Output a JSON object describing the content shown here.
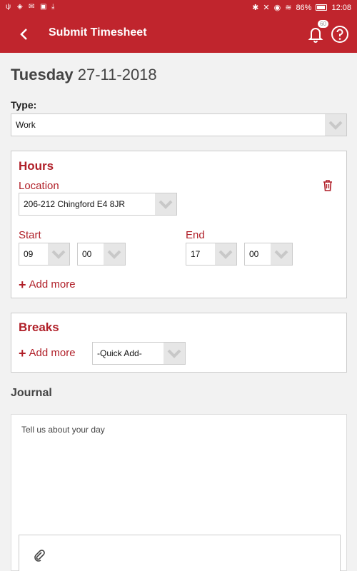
{
  "status_bar": {
    "battery": "86%",
    "time": "12:08"
  },
  "app_bar": {
    "title": "Submit Timesheet",
    "notification_count": "60"
  },
  "date": {
    "day": "Tuesday",
    "date": "27-11-2018"
  },
  "type": {
    "label": "Type:",
    "value": "Work"
  },
  "hours": {
    "title": "Hours",
    "location_label": "Location",
    "location_value": "206-212 Chingford E4 8JR",
    "start_label": "Start",
    "start_hour": "09",
    "start_minute": "00",
    "end_label": "End",
    "end_hour": "17",
    "end_minute": "00",
    "add_more": "Add more"
  },
  "breaks": {
    "title": "Breaks",
    "add_more": "Add more",
    "quick_add": "-Quick Add-"
  },
  "journal": {
    "label": "Journal",
    "placeholder": "Tell us about your day"
  },
  "colors": {
    "accent": "#c0252d",
    "label_red": "#b01f28"
  }
}
